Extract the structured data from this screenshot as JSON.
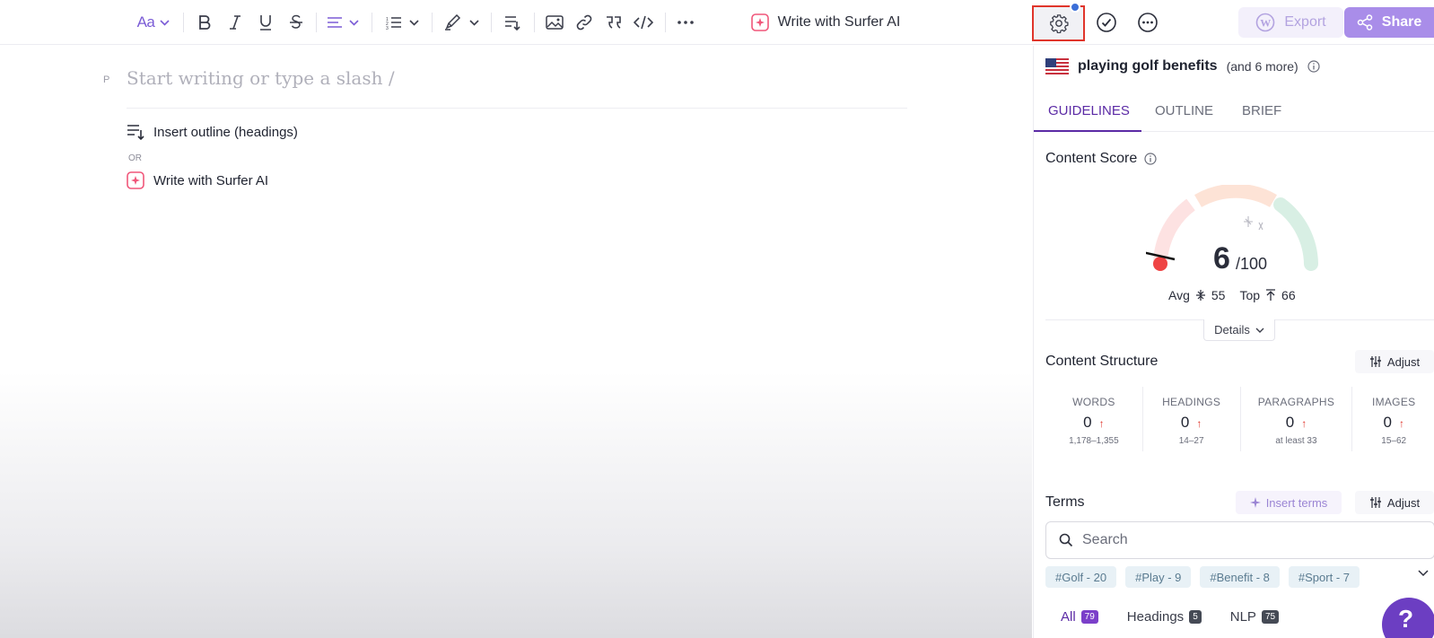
{
  "toolbar": {
    "font_label": "Aa",
    "surfer_ai_label": "Write with Surfer AI",
    "export_label": "Export",
    "share_label": "Share"
  },
  "editor": {
    "block_marker": "P",
    "placeholder": "Start writing or type a slash /",
    "insert_outline_label": "Insert outline (headings)",
    "or_label": "OR",
    "write_ai_label": "Write with Surfer AI"
  },
  "sidebar": {
    "keyword": "playing golf benefits",
    "keyword_more": "(and 6 more)",
    "tabs": [
      {
        "label": "GUIDELINES",
        "active": true
      },
      {
        "label": "OUTLINE",
        "active": false
      },
      {
        "label": "BRIEF",
        "active": false
      }
    ],
    "content_score": {
      "title": "Content Score",
      "score": "6",
      "max": "/100",
      "avg_label": "Avg",
      "avg_value": "55",
      "top_label": "Top",
      "top_value": "66",
      "details_label": "Details"
    },
    "content_structure": {
      "title": "Content Structure",
      "adjust_label": "Adjust",
      "metrics": [
        {
          "label": "WORDS",
          "value": "0",
          "range": "1,178–1,355"
        },
        {
          "label": "HEADINGS",
          "value": "0",
          "range": "14–27"
        },
        {
          "label": "PARAGRAPHS",
          "value": "0",
          "range": "at least 33"
        },
        {
          "label": "IMAGES",
          "value": "0",
          "range": "15–62"
        }
      ]
    },
    "terms": {
      "title": "Terms",
      "insert_label": "Insert terms",
      "adjust_label": "Adjust",
      "search_placeholder": "Search",
      "chips": [
        "#Golf - 20",
        "#Play - 9",
        "#Benefit - 8",
        "#Sport - 7"
      ],
      "filters": [
        {
          "label": "All",
          "count": "79"
        },
        {
          "label": "Headings",
          "count": "5"
        },
        {
          "label": "NLP",
          "count": "75"
        }
      ]
    }
  },
  "colors": {
    "accent": "#5b2aa5",
    "share_bg": "#a98de9",
    "highlight_border": "#e0352b",
    "score_low": "#ef4444"
  }
}
